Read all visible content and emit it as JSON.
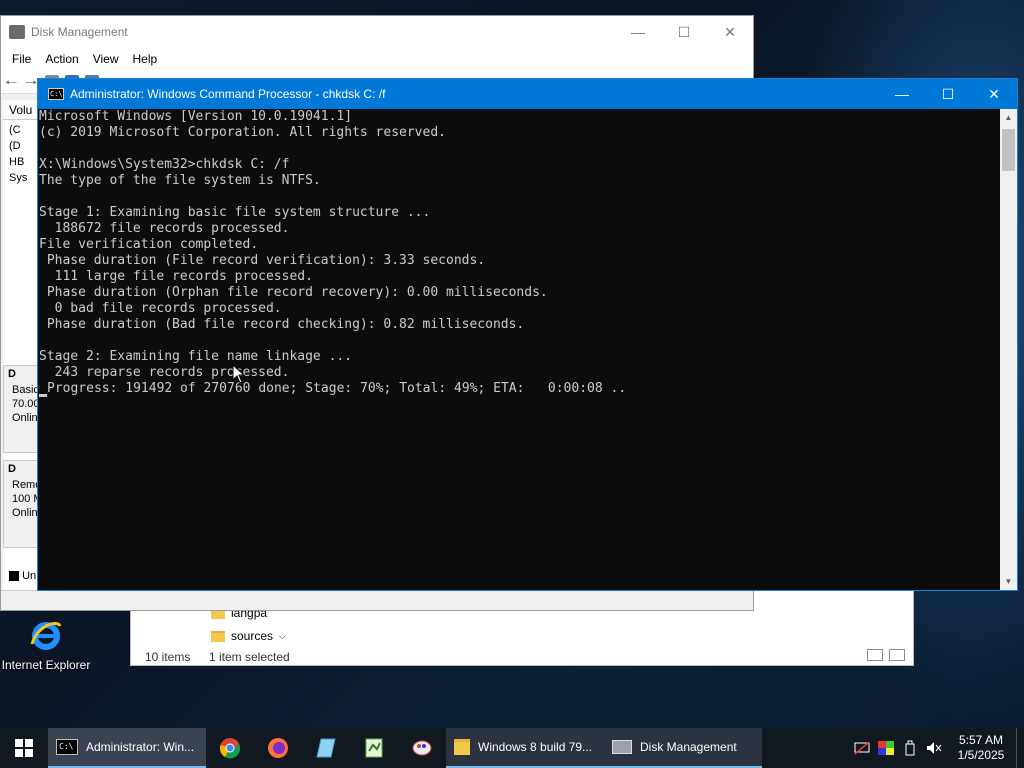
{
  "desktop": {
    "icons": [
      {
        "label": "Internet Explorer",
        "icon": "internet-explorer-icon"
      }
    ]
  },
  "explorer": {
    "files": [
      "langpa",
      "sources"
    ],
    "status_items": "10 items",
    "status_selected": "1 item selected"
  },
  "disk_management": {
    "title": "Disk Management",
    "menu": [
      "File",
      "Action",
      "View",
      "Help"
    ],
    "side_header": "Volu",
    "side_rows": [
      "(C",
      "(D",
      "HB",
      "Sys"
    ],
    "disk0": {
      "name": "D",
      "type": "Basic",
      "size": "70.00",
      "status": "Onlin"
    },
    "disk1": {
      "name": "D",
      "type": "Remo",
      "size": "100 M",
      "status": "Onlin"
    },
    "legend": "Un"
  },
  "cmd": {
    "title": "Administrator: Windows Command Processor - chkdsk  C: /f",
    "lines": [
      "Microsoft Windows [Version 10.0.19041.1]",
      "(c) 2019 Microsoft Corporation. All rights reserved.",
      "",
      "X:\\Windows\\System32>chkdsk C: /f",
      "The type of the file system is NTFS.",
      "",
      "Stage 1: Examining basic file system structure ...",
      "  188672 file records processed.",
      "File verification completed.",
      " Phase duration (File record verification): 3.33 seconds.",
      "  111 large file records processed.",
      " Phase duration (Orphan file record recovery): 0.00 milliseconds.",
      "  0 bad file records processed.",
      " Phase duration (Bad file record checking): 0.82 milliseconds.",
      "",
      "Stage 2: Examining file name linkage ...",
      "  243 reparse records processed.",
      "Progress: 191492 of 270760 done; Stage: 70%; Total: 49%; ETA:   0:00:08 .."
    ]
  },
  "taskbar": {
    "items": [
      {
        "label": "Administrator: Win...",
        "icon": "cmd-icon"
      },
      {
        "label": "Windows 8 build 79...",
        "icon": "folder-icon"
      },
      {
        "label": "Disk Management",
        "icon": "disk-management-icon"
      }
    ],
    "pinned": [
      "chrome-icon",
      "firefox-icon",
      "notepad-icon",
      "notepad-plus-plus-icon",
      "paint-icon"
    ],
    "tray_icons": [
      "network-icon",
      "color-icon",
      "usb-icon",
      "volume-muted-icon"
    ],
    "time": "5:57 AM",
    "date": "1/5/2025"
  },
  "colors": {
    "titlebar_active": "#0078d7",
    "console_bg": "#0c0c0c",
    "console_fg": "#cccccc",
    "taskbar_bg": "#101820"
  }
}
